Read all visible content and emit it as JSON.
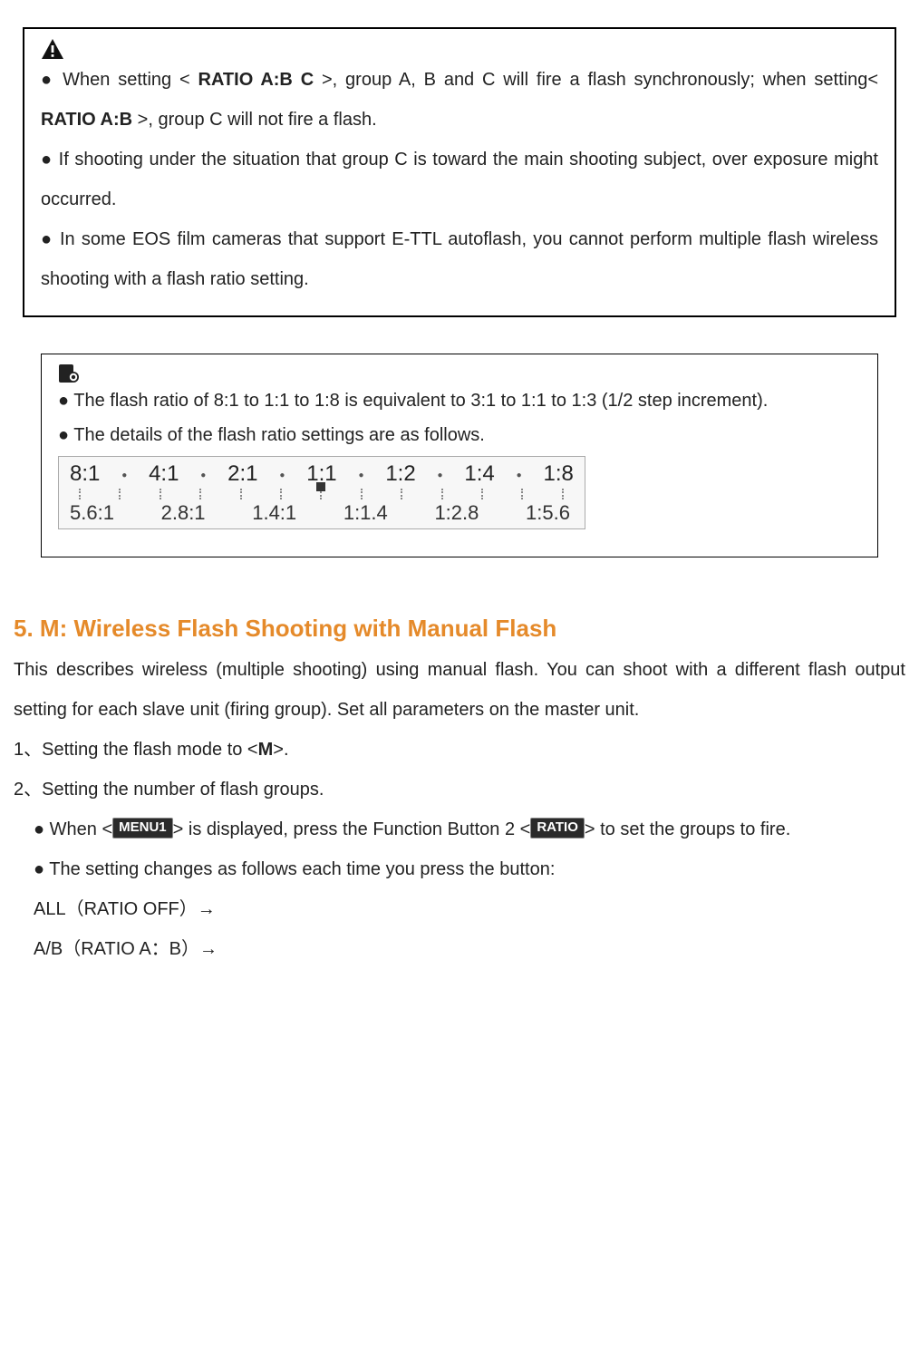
{
  "warning_box": {
    "b1_pre": "● When setting < ",
    "b1_bold1": "RATIO A:B C",
    "b1_mid": " >, group A, B and C will fire a flash synchronously; when setting< ",
    "b1_bold2": "RATIO A:B",
    "b1_post": " >, group C will not fire a flash.",
    "b2": "● If shooting under the situation that group C is toward the main shooting subject, over exposure might occurred.",
    "b3": "● In some EOS film cameras that support E-TTL autoflash, you cannot perform multiple flash wireless shooting with a flash ratio setting."
  },
  "info_box": {
    "b1": "● The flash ratio of 8:1 to 1:1 to 1:8 is equivalent to 3:1 to 1:1 to 1:3 (1/2 step increment).",
    "b2": "● The details of the flash ratio settings are as follows.",
    "scale_top": [
      "8:1",
      "4:1",
      "2:1",
      "1:1",
      "1:2",
      "1:4",
      "1:8"
    ],
    "scale_bot": [
      "5.6:1",
      "2.8:1",
      "1.4:1",
      "1:1.4",
      "1:2.8",
      "1:5.6"
    ]
  },
  "section": {
    "heading": "5. M: Wireless Flash Shooting with Manual Flash",
    "intro": "This describes wireless (multiple shooting) using manual flash. You can shoot with a different flash output setting for each slave unit (firing group). Set all parameters on the master unit.",
    "step1_pre": "1、Setting the flash mode to <",
    "step1_bold": "M",
    "step1_post": ">.",
    "step2": "2、Setting the number of flash groups.",
    "sub1_pre": "● When <",
    "badge_menu1": "MENU1",
    "sub1_mid": "> is displayed, press the Function Button 2 <",
    "badge_ratio": "RATIO",
    "sub1_post": "> to set the groups to fire.",
    "sub2": "● The setting changes as follows each time you press the button:",
    "seq1": "ALL（RATIO OFF）→",
    "seq2": "A/B（RATIO A：B）→"
  }
}
